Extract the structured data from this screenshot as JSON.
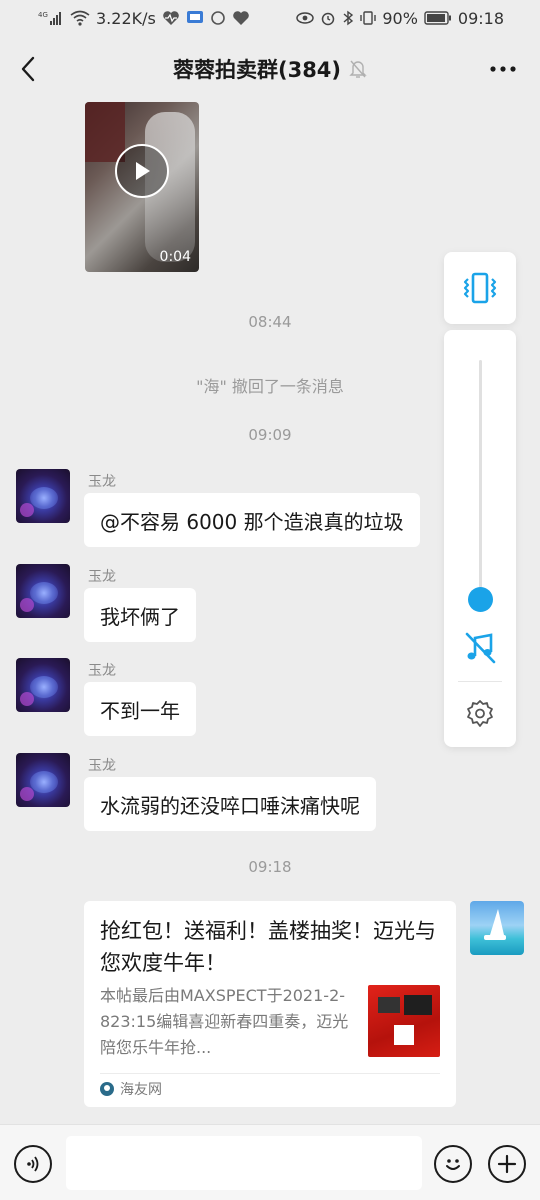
{
  "status_bar": {
    "network_type": "4G",
    "speed": "3.22K/s",
    "battery": "90%",
    "time": "09:18"
  },
  "header": {
    "title": "蓉蓉拍卖群(384)"
  },
  "video": {
    "duration": "0:04"
  },
  "timeline": {
    "t1": "08:44",
    "recall_notice": "\"海\" 撤回了一条消息",
    "t2": "09:09",
    "t3": "09:18"
  },
  "messages": [
    {
      "sender": "玉龙",
      "text": "@不容易  6000 那个造浪真的垃圾"
    },
    {
      "sender": "玉龙",
      "text": "我坏俩了"
    },
    {
      "sender": "玉龙",
      "text": "不到一年"
    },
    {
      "sender": "玉龙",
      "text": "水流弱的还没啐口唾沫痛快呢"
    }
  ],
  "link_card": {
    "title": "抢红包！送福利！盖楼抽奖！迈光与您欢度牛年！",
    "body": "本帖最后由MAXSPECT于2021-2-823:15编辑喜迎新春四重奏，迈光陪您乐牛年抢...",
    "source": "海友网"
  },
  "volume_panel": {
    "level": 0.05
  },
  "colors": {
    "accent": "#1aa3e8",
    "background": "#ededed"
  }
}
